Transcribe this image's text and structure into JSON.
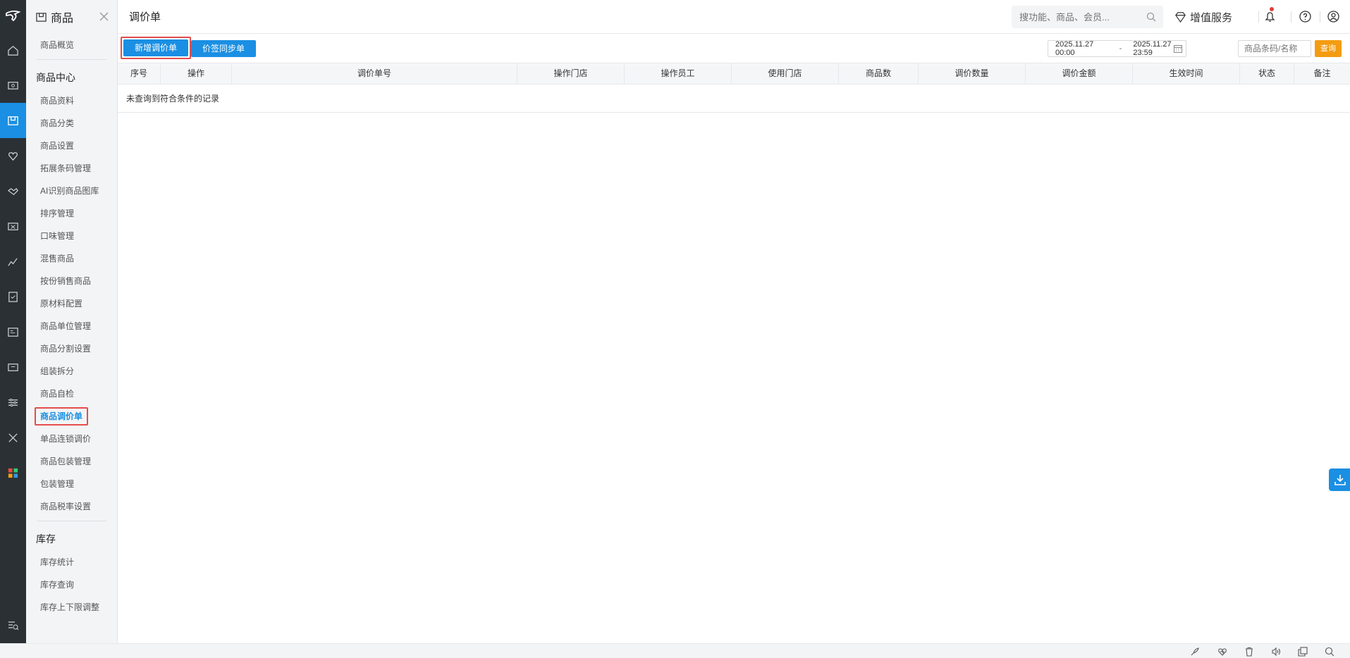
{
  "sidebar_module": {
    "title": "商品"
  },
  "submenu": {
    "overview": "商品概览",
    "group_center": "商品中心",
    "center_items": [
      "商品资料",
      "商品分类",
      "商品设置",
      "拓展条码管理",
      "AI识别商品图库",
      "排序管理",
      "口味管理",
      "混售商品",
      "按份销售商品",
      "原材料配置",
      "商品单位管理",
      "商品分割设置",
      "组装拆分",
      "商品自检",
      "商品调价单",
      "单品连锁调价",
      "商品包装管理",
      "包装管理",
      "商品税率设置"
    ],
    "active_item": "商品调价单",
    "group_stock": "库存",
    "stock_items": [
      "库存统计",
      "库存查询",
      "库存上下限调整"
    ]
  },
  "header": {
    "title": "调价单",
    "search_placeholder": "搜功能、商品、会员...",
    "value_added": "增值服务"
  },
  "toolbar": {
    "add_label": "新增调价单",
    "sync_label": "价签同步单",
    "date_start": "2025.11.27 00:00",
    "date_sep": "-",
    "date_end": "2025.11.27 23:59",
    "goods_placeholder": "商品条码/名称",
    "query_label": "查询"
  },
  "table": {
    "columns": [
      "序号",
      "操作",
      "调价单号",
      "操作门店",
      "操作员工",
      "使用门店",
      "商品数",
      "调价数量",
      "调价金额",
      "生效时间",
      "状态",
      "备注"
    ],
    "empty_text": "未查询到符合条件的记录"
  },
  "colors": {
    "primary": "#1a8fe3",
    "warning": "#f39c12",
    "highlight": "#e44d4d",
    "rail": "#2b3035"
  }
}
